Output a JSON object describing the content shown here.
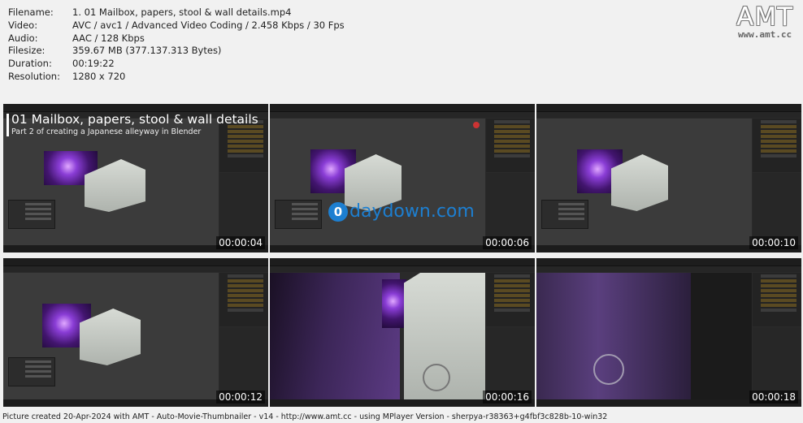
{
  "meta": [
    {
      "key": "Filename:",
      "value": "1. 01 Mailbox, papers, stool & wall details.mp4"
    },
    {
      "key": "Video:",
      "value": "AVC / avc1 / Advanced Video Coding / 2.458 Kbps / 30 Fps"
    },
    {
      "key": "Audio:",
      "value": "AAC / 128 Kbps"
    },
    {
      "key": "Filesize:",
      "value": "359.67 MB (377.137.313 Bytes)"
    },
    {
      "key": "Duration:",
      "value": "00:19:22"
    },
    {
      "key": "Resolution:",
      "value": "1280 x 720"
    }
  ],
  "logo": {
    "big": "AMT",
    "small": "www.amt.cc"
  },
  "overlay": {
    "title": "01 Mailbox, papers, stool & wall details",
    "subtitle": "Part 2 of creating a Japanese alleyway in Blender"
  },
  "watermark": {
    "mark": "0",
    "text": "daydown.com"
  },
  "thumbnails": [
    {
      "timestamp": "00:00:04"
    },
    {
      "timestamp": "00:00:06"
    },
    {
      "timestamp": "00:00:10"
    },
    {
      "timestamp": "00:00:12"
    },
    {
      "timestamp": "00:00:16"
    },
    {
      "timestamp": "00:00:18"
    }
  ],
  "footer": "Picture created 20-Apr-2024 with AMT - Auto-Movie-Thumbnailer - v14 - http://www.amt.cc - using MPlayer Version - sherpya-r38363+g4fbf3c828b-10-win32"
}
